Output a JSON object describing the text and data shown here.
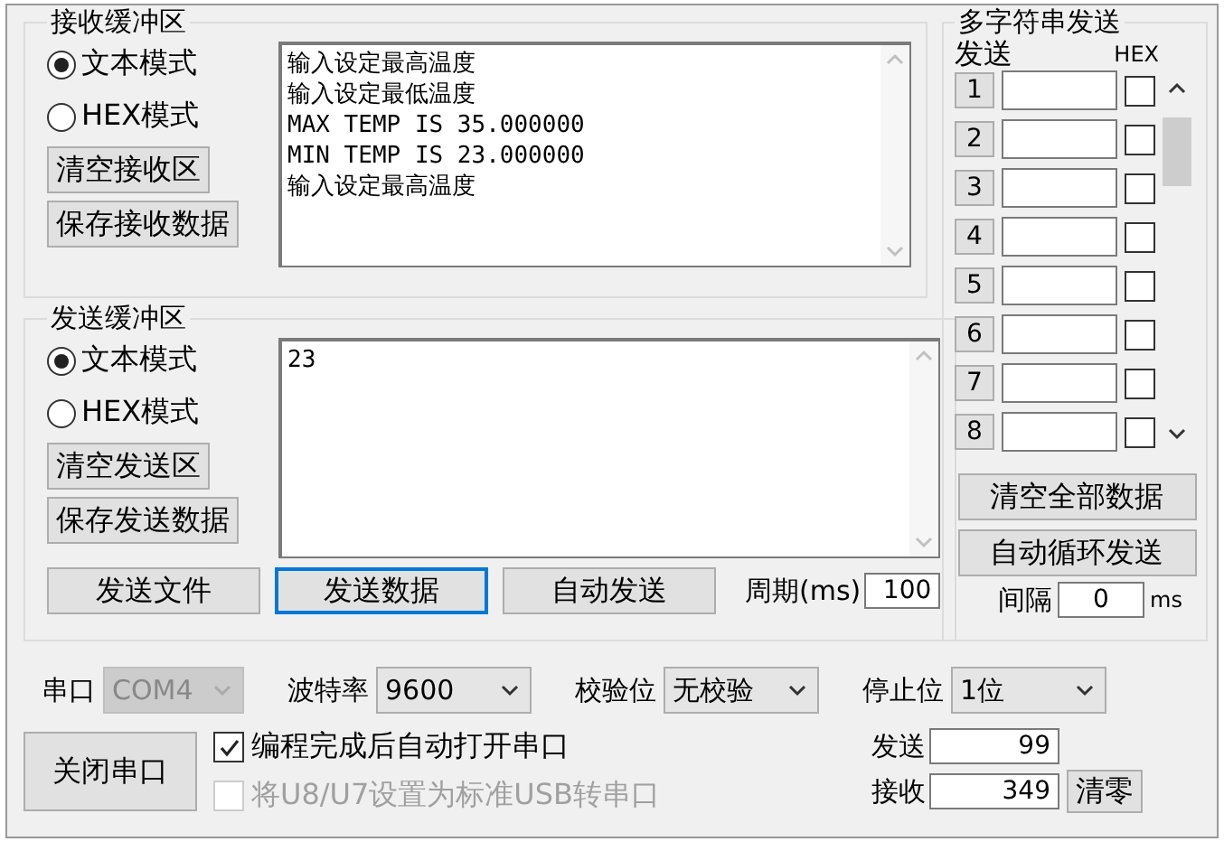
{
  "receive_buffer": {
    "title": "接收缓冲区",
    "modes": [
      {
        "label": "文本模式",
        "selected": true
      },
      {
        "label": "HEX模式",
        "selected": false
      }
    ],
    "buttons": [
      "清空接收区",
      "保存接收数据"
    ],
    "text_lines": [
      "输入设定最高温度",
      "输入设定最低温度",
      "MAX TEMP IS 35.000000",
      "MIN TEMP IS 23.000000",
      "输入设定最高温度"
    ]
  },
  "send_buffer": {
    "title": "发送缓冲区",
    "modes": [
      {
        "label": "文本模式",
        "selected": true
      },
      {
        "label": "HEX模式",
        "selected": false
      }
    ],
    "buttons": [
      "清空发送区",
      "保存发送数据"
    ],
    "value": "23",
    "actions": [
      {
        "label": "发送文件",
        "focused": false
      },
      {
        "label": "发送数据",
        "focused": true
      },
      {
        "label": "自动发送",
        "focused": false
      }
    ],
    "period_label": "周期(ms)",
    "period_value": "100"
  },
  "multi_send": {
    "title": "多字符串发送",
    "send_header": "发送",
    "hex_header": "HEX",
    "rows": [
      {
        "number": "1",
        "hex_checked": false
      },
      {
        "number": "2",
        "hex_checked": false
      },
      {
        "number": "3",
        "hex_checked": false
      },
      {
        "number": "4",
        "hex_checked": false
      },
      {
        "number": "5",
        "hex_checked": false
      },
      {
        "number": "6",
        "hex_checked": false
      },
      {
        "number": "7",
        "hex_checked": false
      },
      {
        "number": "8",
        "hex_checked": false
      }
    ],
    "buttons": [
      "清空全部数据",
      "自动循环发送"
    ],
    "interval_label": "间隔",
    "interval_value": "0",
    "interval_unit": "ms"
  },
  "settings": [
    {
      "label": "串口",
      "value": "COM4",
      "disabled": true
    },
    {
      "label": "波特率",
      "value": "9600",
      "disabled": false
    },
    {
      "label": "校验位",
      "value": "无校验",
      "disabled": false
    },
    {
      "label": "停止位",
      "value": "1位",
      "disabled": false
    }
  ],
  "close_port_button": "关闭串口",
  "options": [
    {
      "label": "编程完成后自动打开串口",
      "checked": true,
      "disabled": false
    },
    {
      "label": "将U8/U7设置为标准USB转串口",
      "checked": false,
      "disabled": true
    }
  ],
  "counters": [
    {
      "label": "发送",
      "value": "99"
    },
    {
      "label": "接收",
      "value": "349"
    }
  ],
  "reset_button": "清零"
}
